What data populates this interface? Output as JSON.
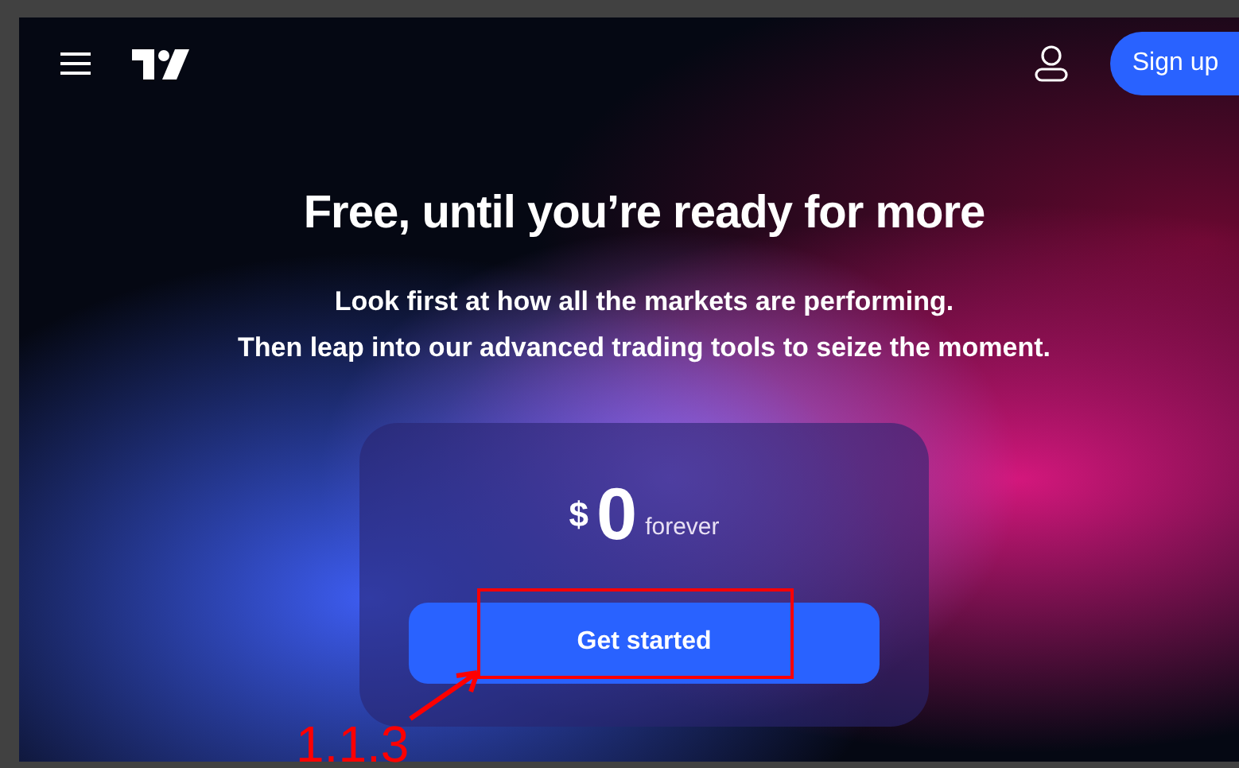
{
  "header": {
    "sign_up": "Sign up"
  },
  "hero": {
    "title": "Free, until you’re ready for more",
    "subtitle_lines": [
      "Look first at how all the markets are performing.",
      "Then leap into our advanced trading tools to seize the moment."
    ]
  },
  "pricing": {
    "currency": "$",
    "amount": "0",
    "period": "forever",
    "button": "Get started"
  },
  "annotation": {
    "label": "1.1.3"
  }
}
